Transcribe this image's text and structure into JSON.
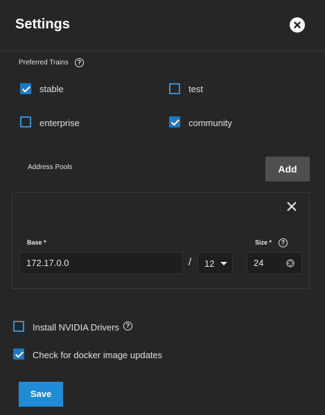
{
  "header": {
    "title": "Settings",
    "close_icon": "close-circle-icon"
  },
  "preferred_trains": {
    "label": "Preferred Trains",
    "help_icon": "help-circle-icon",
    "options": [
      {
        "label": "stable",
        "checked": true
      },
      {
        "label": "test",
        "checked": false
      },
      {
        "label": "enterprise",
        "checked": false
      },
      {
        "label": "community",
        "checked": true
      }
    ]
  },
  "address_pools": {
    "label": "Address Pools",
    "add_label": "Add",
    "pool": {
      "remove_icon": "close-icon",
      "base_label": "Base *",
      "base_value": "172.17.0.0",
      "separator": "/",
      "netmask_value": "12",
      "size_label": "Size *",
      "size_value": "24",
      "size_help_icon": "help-circle-icon",
      "clear_icon": "clear-icon"
    }
  },
  "install_nvidia": {
    "label": "Install NVIDIA Drivers",
    "checked": false,
    "help_icon": "help-circle-icon"
  },
  "check_updates": {
    "label": "Check for docker image updates",
    "checked": true
  },
  "save_label": "Save",
  "colors": {
    "accent": "#1f8ad6",
    "background": "#262626",
    "button_secondary": "#4e4e4e"
  }
}
